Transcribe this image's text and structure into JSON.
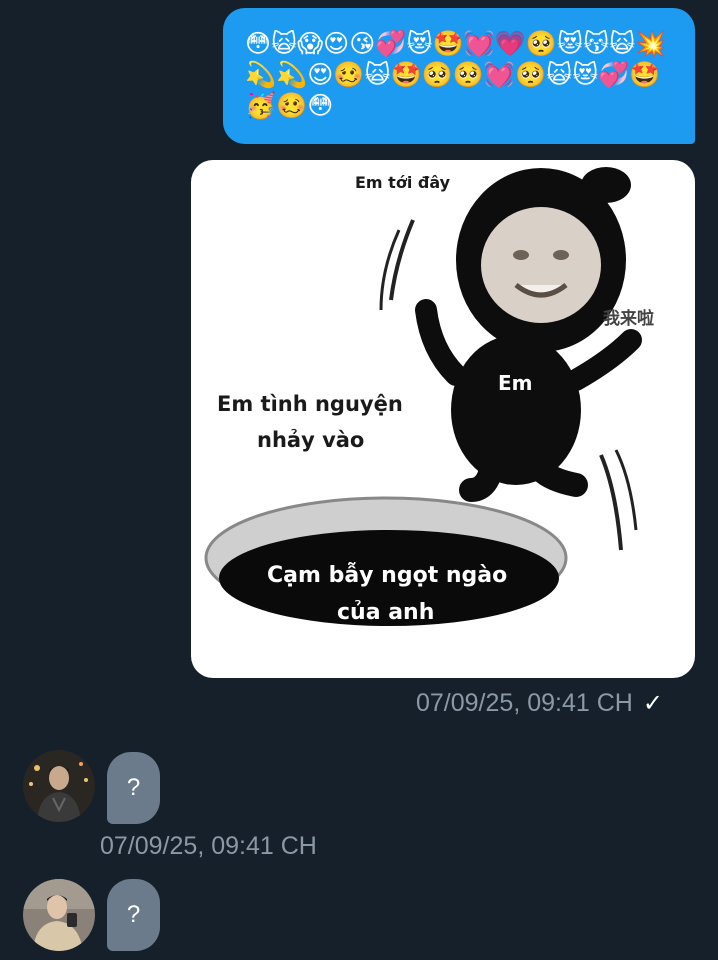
{
  "sent_emoji_message": {
    "text": "😳🙀😱😍😘💞😻🤩💓💗🥺😻😽🙀💥💫💫😍🥴🙀🤩🥺🥺💓🥺🙀😻💞🤩🥳🥴😳"
  },
  "sent_image_message": {
    "meme": {
      "label_top": "Em tới đây",
      "label_body": "Em",
      "label_left_line1": "Em tình nguyện",
      "label_left_line2": "nhảy vào",
      "label_pit_line1": "Cạm bẫy ngọt ngào",
      "label_pit_line2": "của anh",
      "label_chinese": "我来啦"
    },
    "timestamp": "07/09/25, 09:41 CH",
    "status_icon": "check"
  },
  "received_messages": [
    {
      "text": "?",
      "timestamp": "07/09/25, 09:41 CH",
      "avatar": "user-avatar-dark-jacket"
    },
    {
      "text": "?",
      "avatar": "user-avatar-beige-jacket"
    }
  ],
  "colors": {
    "background": "#15202b",
    "sent_bubble": "#1d9bf0",
    "received_bubble": "#6b7b8c",
    "meta_text": "#8b98a5"
  }
}
